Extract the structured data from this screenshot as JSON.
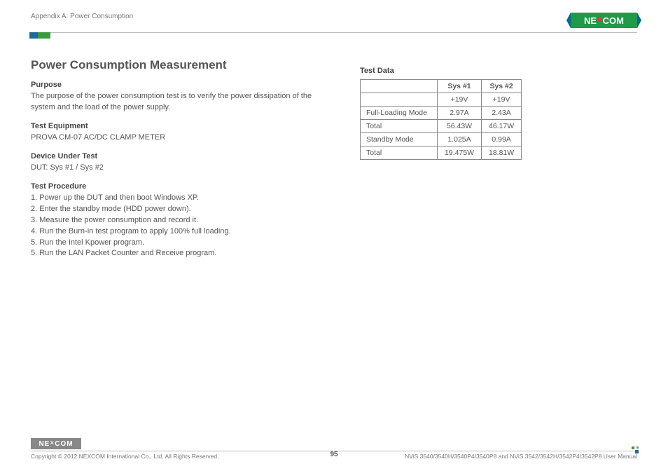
{
  "header": {
    "breadcrumb": "Appendix A: Power Consumption",
    "logo_text": "NE COM",
    "logo_x": "✕"
  },
  "main": {
    "title": "Power Consumption Measurement",
    "sections": {
      "purpose": {
        "heading": "Purpose",
        "body": "The purpose of the power consumption test is to verify the power dissipation of the system and the load of the power supply."
      },
      "equipment": {
        "heading": "Test Equipment",
        "body": "PROVA CM-07 AC/DC CLAMP METER"
      },
      "dut": {
        "heading": "Device Under Test",
        "body": "DUT: Sys #1 / Sys #2"
      },
      "procedure": {
        "heading": "Test Procedure",
        "steps": [
          "1. Power up the DUT and then boot Windows XP.",
          "2. Enter the standby mode (HDD power down).",
          "3. Measure the power consumption and record it.",
          "4. Run the Burn-in test program to apply 100% full loading.",
          "5. Run the Intel Kpower program.",
          "5. Run the LAN Packet Counter and Receive program."
        ]
      }
    },
    "testdata": {
      "heading": "Test Data",
      "columns": [
        "",
        "Sys #1",
        "Sys #2"
      ],
      "rows": [
        {
          "label": "",
          "c1": "+19V",
          "c2": "+19V"
        },
        {
          "label": "Full-Loading Mode",
          "c1": "2.97A",
          "c2": "2.43A"
        },
        {
          "label": "Total",
          "c1": "56.43W",
          "c2": "46.17W"
        },
        {
          "label": "Standby Mode",
          "c1": "1.025A",
          "c2": "0.99A"
        },
        {
          "label": "Total",
          "c1": "19.475W",
          "c2": "18.81W"
        }
      ]
    }
  },
  "footer": {
    "logo_text": "NE COM",
    "copyright": "Copyright © 2012 NEXCOM International Co., Ltd. All Rights Reserved.",
    "page": "95",
    "doc": "NViS 3540/3540H/3540P4/3540P8 and NViS 3542/3542H/3542P4/3542P8 User Manual"
  }
}
